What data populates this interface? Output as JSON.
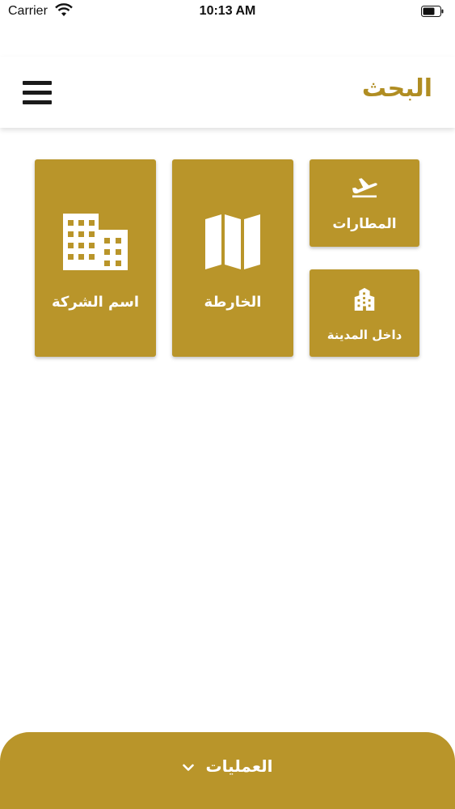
{
  "status_bar": {
    "carrier": "Carrier",
    "time": "10:13 AM"
  },
  "header": {
    "title": "البحث",
    "title_color": "#b08d22",
    "menu_icon": "hamburger-menu-icon"
  },
  "tiles": [
    {
      "label": "المطارات",
      "icon": "airplane-departure-icon"
    },
    {
      "label": "داخل المدينة",
      "icon": "city-building-icon"
    },
    {
      "label": "الخارطة",
      "icon": "map-icon"
    },
    {
      "label": "اسم الشركة",
      "icon": "office-building-icon"
    }
  ],
  "bottom_bar": {
    "label": "العمليات",
    "icon": "chevron-down-icon"
  },
  "colors": {
    "accent": "#b9952a",
    "text_on_accent": "#ffffff"
  }
}
